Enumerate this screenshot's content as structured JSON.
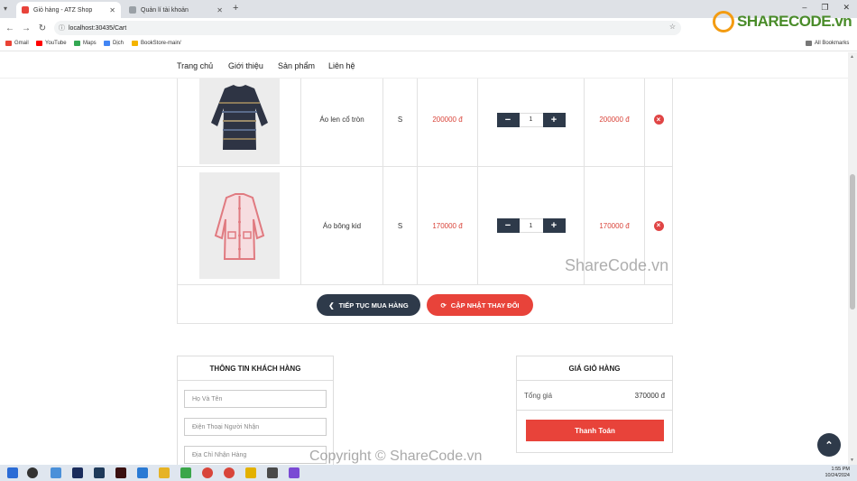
{
  "browser": {
    "tabs": [
      {
        "title": "Giỏ hàng - ATZ Shop",
        "active": true
      },
      {
        "title": "Quản lí tài khoản",
        "active": false
      }
    ],
    "url": "localhost:30435/Cart",
    "bookmarks": [
      "Gmail",
      "YouTube",
      "Maps",
      "Dịch",
      "BookStore-main/"
    ],
    "all_bookmarks": "All Bookmarks"
  },
  "nav": {
    "items": [
      "Trang chủ",
      "Giới thiệu",
      "Sản phẩm",
      "Liên hệ"
    ]
  },
  "cart": {
    "items": [
      {
        "name": "Áo len cổ tròn",
        "size": "S",
        "price": "200000 đ",
        "quantity": "1",
        "total": "200000 đ",
        "image": "dark-striped-sweater"
      },
      {
        "name": "Áo bông kid",
        "size": "S",
        "price": "170000 đ",
        "quantity": "1",
        "total": "170000 đ",
        "image": "pink-tweed-jacket"
      }
    ],
    "continue_label": "TIẾP TỤC MUA HÀNG",
    "update_label": "CẬP NHẬT THAY ĐỔI"
  },
  "customer": {
    "title": "THÔNG TIN KHÁCH HÀNG",
    "name_placeholder": "Họ Và Tên",
    "phone_placeholder": "Điện Thoại Người Nhận",
    "address_placeholder": "Địa Chỉ Nhận Hàng"
  },
  "summary": {
    "title": "GIÁ GIỎ HÀNG",
    "total_label": "Tổng giá",
    "total_value": "370000 đ",
    "checkout_label": "Thanh Toán"
  },
  "watermarks": {
    "logo": "SHARECODE.vn",
    "middle": "ShareCode.vn",
    "bottom": "Copyright © ShareCode.vn"
  },
  "taskbar": {
    "time": "1:55 PM",
    "date": "10/24/2024"
  },
  "colors": {
    "accent_red": "#e8433a",
    "dark_navy": "#2e3a4a",
    "price_red": "#d9443a"
  }
}
